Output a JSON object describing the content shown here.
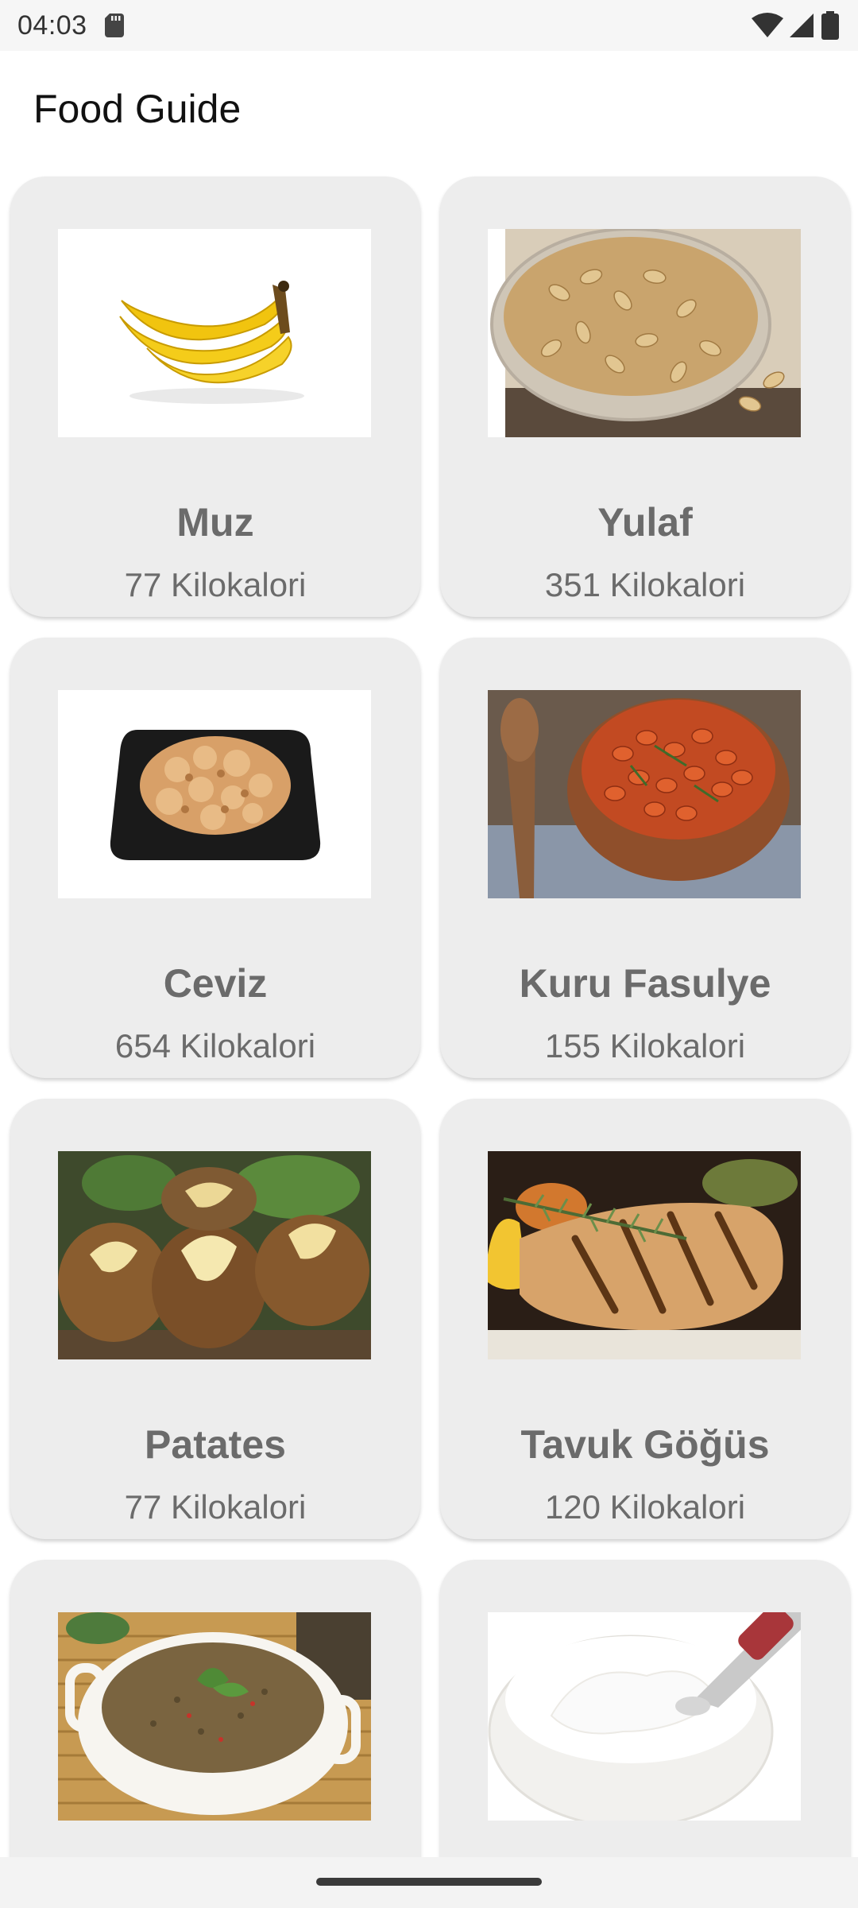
{
  "status_bar": {
    "time": "04:03"
  },
  "app_bar": {
    "title": "Food Guide"
  },
  "foods": [
    {
      "name": "Muz",
      "calories": "77 Kilokalori",
      "image": "banana"
    },
    {
      "name": "Yulaf",
      "calories": "351 Kilokalori",
      "image": "oats"
    },
    {
      "name": "Ceviz",
      "calories": "654 Kilokalori",
      "image": "walnuts"
    },
    {
      "name": "Kuru Fasulye",
      "calories": "155 Kilokalori",
      "image": "beans"
    },
    {
      "name": "Patates",
      "calories": "77 Kilokalori",
      "image": "baked-potatoes"
    },
    {
      "name": "Tavuk Göğüs",
      "calories": "120 Kilokalori",
      "image": "grilled-chicken"
    },
    {
      "name": "",
      "calories": "",
      "image": "lentil-soup"
    },
    {
      "name": "",
      "calories": "",
      "image": "yogurt"
    }
  ]
}
